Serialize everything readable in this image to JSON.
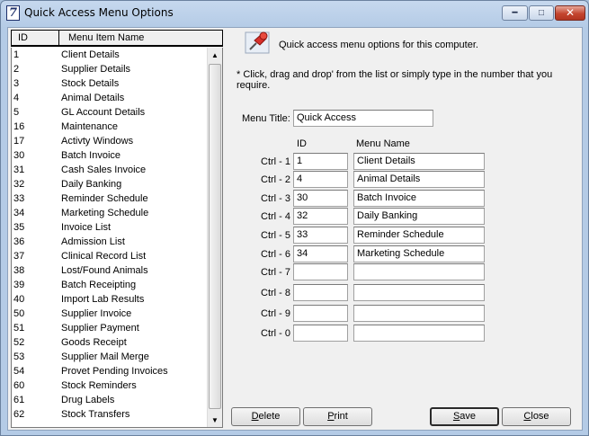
{
  "window": {
    "title": "Quick Access Menu Options",
    "app_icon_glyph": "7"
  },
  "list": {
    "headers": {
      "id": "ID",
      "name": "Menu Item Name"
    },
    "items": [
      {
        "id": "1",
        "name": "Client Details"
      },
      {
        "id": "2",
        "name": "Supplier Details"
      },
      {
        "id": "3",
        "name": "Stock Details"
      },
      {
        "id": "4",
        "name": "Animal Details"
      },
      {
        "id": "5",
        "name": "GL Account Details"
      },
      {
        "id": "16",
        "name": "Maintenance"
      },
      {
        "id": "17",
        "name": "Activty Windows"
      },
      {
        "id": "30",
        "name": "Batch Invoice"
      },
      {
        "id": "31",
        "name": "Cash Sales Invoice"
      },
      {
        "id": "32",
        "name": "Daily Banking"
      },
      {
        "id": "33",
        "name": "Reminder Schedule"
      },
      {
        "id": "34",
        "name": "Marketing Schedule"
      },
      {
        "id": "35",
        "name": "Invoice List"
      },
      {
        "id": "36",
        "name": "Admission List"
      },
      {
        "id": "37",
        "name": "Clinical Record List"
      },
      {
        "id": "38",
        "name": "Lost/Found Animals"
      },
      {
        "id": "39",
        "name": "Batch Receipting"
      },
      {
        "id": "40",
        "name": "Import Lab Results"
      },
      {
        "id": "50",
        "name": "Supplier Invoice"
      },
      {
        "id": "51",
        "name": "Supplier Payment"
      },
      {
        "id": "52",
        "name": "Goods Receipt"
      },
      {
        "id": "53",
        "name": "Supplier Mail Merge"
      },
      {
        "id": "54",
        "name": "Provet Pending Invoices"
      },
      {
        "id": "60",
        "name": "Stock Reminders"
      },
      {
        "id": "61",
        "name": "Drug Labels"
      },
      {
        "id": "62",
        "name": "Stock Transfers"
      }
    ]
  },
  "panel": {
    "info_text": "Quick access menu options for this computer.",
    "hint_text": "* Click, drag and drop' from the list or simply type in the number that you require.",
    "menu_title_label": "Menu Title:",
    "menu_title_value": "Quick Access",
    "col_id": "ID",
    "col_menu_name": "Menu Name",
    "slots": [
      {
        "label": "Ctrl - 1",
        "id": "1",
        "name": "Client Details"
      },
      {
        "label": "Ctrl - 2",
        "id": "4",
        "name": "Animal Details"
      },
      {
        "label": "Ctrl - 3",
        "id": "30",
        "name": "Batch Invoice"
      },
      {
        "label": "Ctrl - 4",
        "id": "32",
        "name": "Daily Banking"
      },
      {
        "label": "Ctrl - 5",
        "id": "33",
        "name": "Reminder Schedule"
      },
      {
        "label": "Ctrl - 6",
        "id": "34",
        "name": "Marketing Schedule"
      },
      {
        "label": "Ctrl - 7",
        "id": "",
        "name": ""
      },
      {
        "label": "Ctrl - 8",
        "id": "",
        "name": ""
      },
      {
        "label": "Ctrl - 9",
        "id": "",
        "name": ""
      },
      {
        "label": "Ctrl - 0",
        "id": "",
        "name": ""
      }
    ]
  },
  "buttons": {
    "delete": {
      "label": "Delete"
    },
    "print": {
      "label": "Print"
    },
    "save": {
      "label": "Save"
    },
    "close": {
      "label": "Close"
    }
  },
  "icons": {
    "pin": "pushpin-icon",
    "scroll_up": "scroll-up-icon",
    "scroll_down": "scroll-down-icon"
  }
}
